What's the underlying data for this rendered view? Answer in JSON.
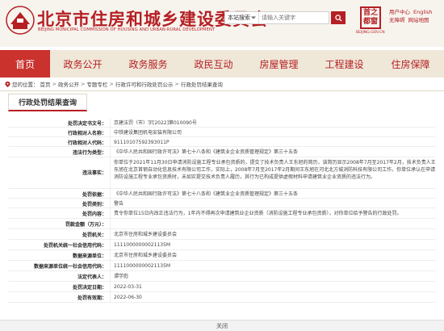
{
  "header": {
    "title": "北京市住房和城乡建设委员会",
    "subtitle": "BEIJING MUNICIPAL COMMISSION OF HOUSING AND URBAN-RURAL DEVELOPMENT",
    "search_scope": "本站搜索",
    "search_placeholder": "请输入关键字",
    "stamp_text": "首之都窗",
    "stamp_caption": "BEIJING.GOV.CN",
    "user_links": [
      [
        "用户中心",
        "English"
      ],
      [
        "无障碍",
        "网站地图"
      ]
    ]
  },
  "nav": {
    "items": [
      "首页",
      "政务公开",
      "政务服务",
      "政民互动",
      "房屋管理",
      "工程建设",
      "住房保障"
    ],
    "active_index": 0
  },
  "breadcrumb": {
    "prefix": "您的位置：",
    "items": [
      "首页",
      "政务公开",
      "专题专栏",
      "行政许可和行政处罚公示",
      "行政处罚结果查询"
    ]
  },
  "panel": {
    "tab_label": "行政处罚结果查询"
  },
  "record": {
    "rows": [
      {
        "label": "处罚决定书文号：",
        "value": [
          "京建法罚（市）字[2022]第010090号"
        ]
      },
      {
        "label": "行政相对人名称：",
        "value": [
          "中铁建设集团机电安装有限公司"
        ]
      },
      {
        "label": "行政相对人代码：",
        "value": [
          "91110107592393011P"
        ]
      },
      {
        "label": "违法行为类型：",
        "value": [
          "《中华人民共和国行政许可法》第七十八条和《建筑业企业资质管理规定》第三十五条"
        ]
      },
      {
        "label": "违法事实：",
        "value": [
          "你单位于2021年11月30日申请消防设施工程专业承包资质的，提交了技术负责人王东旭的简历，该简历显示2008年7月至2017年2月，技术负责人王东旭在北京首钢自动化信息技术有限公司工作，实际上，2008年7月至2017年2月期间王东旭在河北北方城消防科技有限公司工作。你单位承认在申请消防设施工程专业承包资质时，未如实提交技术负责人履历，其行为已构成提供虚假材料申请建筑业企业资质的违法行为。"
        ]
      },
      {
        "label": "处罚依据：",
        "value": [
          "《中华人民共和国行政许可法》第七十八条和《建筑业企业资质管理规定》第三十五条"
        ]
      },
      {
        "label": "处罚类别：",
        "value": [
          "警告"
        ]
      },
      {
        "label": "处罚内容：",
        "value": [
          "责令你单位15日内改正违法行为，1年内不得再次申请建筑业企业资质（消防设施工程专业承包资质），对你单位给予警告的行政处罚。"
        ]
      },
      {
        "label": "罚款金额（万元）：",
        "value": [
          ""
        ]
      },
      {
        "label": "处罚机关：",
        "value": [
          "北京市住房和城乡建设委员会"
        ]
      },
      {
        "label": "处罚机关统一社会信用代码：",
        "value": [
          "11110000000021135M"
        ]
      },
      {
        "label": "数据来源单位：",
        "value": [
          "北京市住房和城乡建设委员会"
        ]
      },
      {
        "label": "数据来源单位统一社会信用代码：",
        "value": [
          "11110000000021135M"
        ]
      },
      {
        "label": "法定代表人：",
        "value": [
          "谭学彪"
        ]
      },
      {
        "label": "处罚决定日期：",
        "value": [
          "2022-03-31"
        ]
      },
      {
        "label": "处罚有效期：",
        "value": [
          "2022-06-30"
        ]
      }
    ]
  },
  "footer": {
    "close_label": "关闭"
  },
  "colors": {
    "brand_red": "#b51f24",
    "nav_bg": "#efe7d8",
    "nav_active": "#c9322d"
  }
}
